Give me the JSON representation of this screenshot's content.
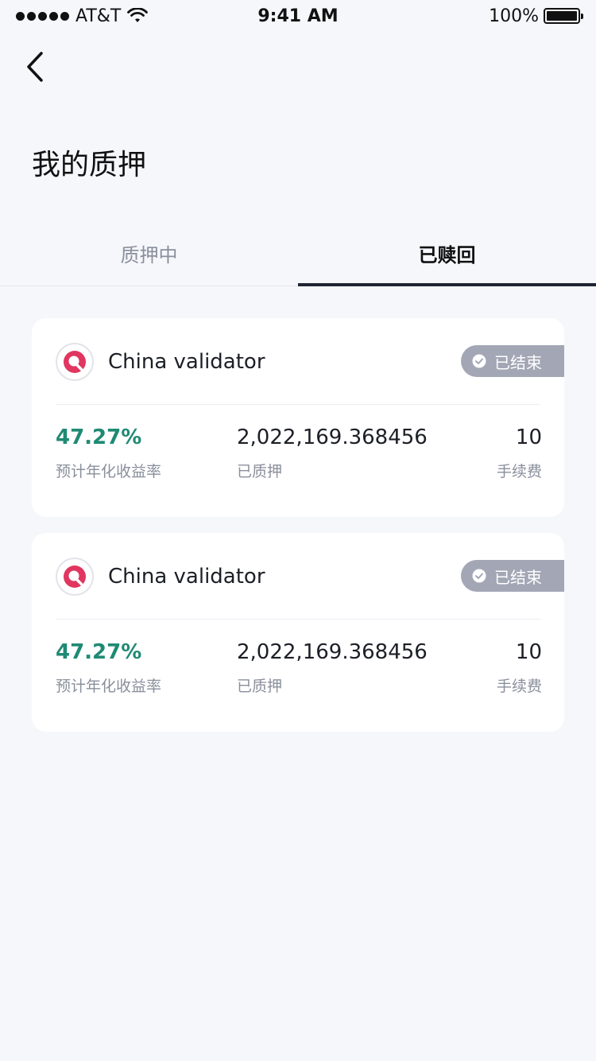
{
  "status_bar": {
    "carrier": "AT&T",
    "time": "9:41 AM",
    "battery_percent": "100%",
    "battery_level": 1.0
  },
  "header": {
    "title": "我的质押"
  },
  "tabs": [
    {
      "label": "质押中",
      "active": false
    },
    {
      "label": "已赎回",
      "active": true
    }
  ],
  "cards": [
    {
      "validator": "China validator",
      "status": "已结束",
      "rate_value": "47.27%",
      "rate_label": "预计年化收益率",
      "staked_value": "2,022,169.368456",
      "staked_label": "已质押",
      "fee_value": "10",
      "fee_label": "手续费"
    },
    {
      "validator": "China validator",
      "status": "已结束",
      "rate_value": "47.27%",
      "rate_label": "预计年化收益率",
      "staked_value": "2,022,169.368456",
      "staked_label": "已质押",
      "fee_value": "10",
      "fee_label": "手续费"
    }
  ],
  "colors": {
    "accent_green": "#1f8a74",
    "badge_gray": "#a3a7b5",
    "logo_red": "#e0365f",
    "tab_indicator": "#1f2633"
  }
}
